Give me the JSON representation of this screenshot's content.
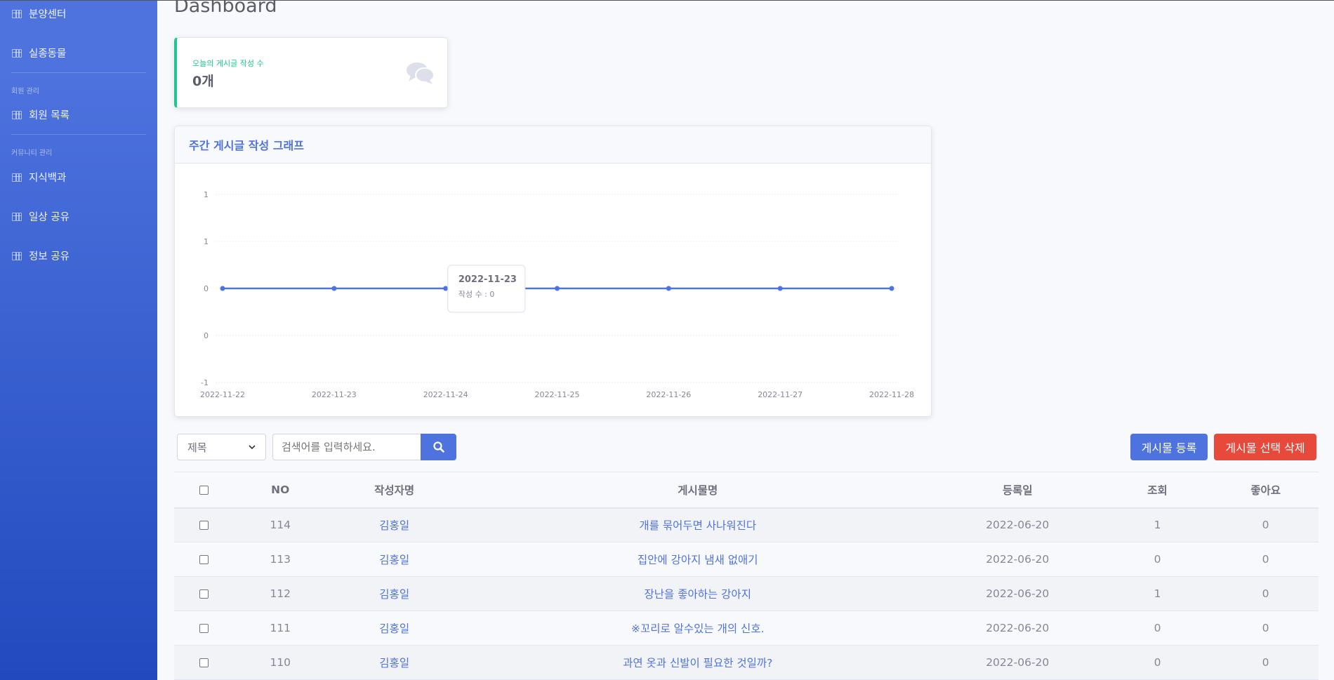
{
  "sidebar": {
    "items_top": [
      {
        "label": "분양센터"
      },
      {
        "label": "실종동물"
      }
    ],
    "section_member": "회원 관리",
    "member_items": [
      {
        "label": "회원 목록"
      }
    ],
    "section_community": "커뮤니티 관리",
    "community_items": [
      {
        "label": "지식백과"
      },
      {
        "label": "일상 공유"
      },
      {
        "label": "정보 공유"
      }
    ]
  },
  "page": {
    "title": "Dashboard"
  },
  "stat": {
    "label": "오늘의 게시글 작성 수",
    "value": "0개",
    "icon": "comments-icon"
  },
  "chart": {
    "header": "주간 게시글 작성 그래프",
    "tooltip_date": "2022-11-23",
    "tooltip_text": "작성 수 : 0"
  },
  "chart_data": {
    "type": "line",
    "title": "주간 게시글 작성 그래프",
    "x": [
      "2022-11-22",
      "2022-11-23",
      "2022-11-24",
      "2022-11-25",
      "2022-11-26",
      "2022-11-27",
      "2022-11-28"
    ],
    "series": [
      {
        "name": "작성 수",
        "values": [
          0,
          0,
          0,
          0,
          0,
          0,
          0
        ]
      }
    ],
    "y_tick_labels": [
      "1",
      "1",
      "0",
      "0",
      "-1"
    ],
    "ylim": [
      -1,
      1
    ],
    "grid": true,
    "color": "#4e73df"
  },
  "search": {
    "select_value": "제목",
    "placeholder": "검색어를 입력하세요."
  },
  "buttons": {
    "register": "게시물 등록",
    "delete": "게시물 선택 삭제"
  },
  "table": {
    "headers": [
      "NO",
      "작성자명",
      "게시물명",
      "등록일",
      "조회",
      "좋아요"
    ],
    "rows": [
      {
        "no": "114",
        "author": "김홍일",
        "title": "개를 묶어두면 사나워진다",
        "date": "2022-06-20",
        "views": "1",
        "likes": "0"
      },
      {
        "no": "113",
        "author": "김홍일",
        "title": "집안에 강아지 냄새 없애기",
        "date": "2022-06-20",
        "views": "0",
        "likes": "0"
      },
      {
        "no": "112",
        "author": "김홍일",
        "title": "장난을 좋아하는 강아지",
        "date": "2022-06-20",
        "views": "1",
        "likes": "0"
      },
      {
        "no": "111",
        "author": "김홍일",
        "title": "※꼬리로 알수있는 개의 신호.",
        "date": "2022-06-20",
        "views": "0",
        "likes": "0"
      },
      {
        "no": "110",
        "author": "김홍일",
        "title": "과연 옷과 신발이 필요한 것일까?",
        "date": "2022-06-20",
        "views": "0",
        "likes": "0"
      }
    ]
  }
}
